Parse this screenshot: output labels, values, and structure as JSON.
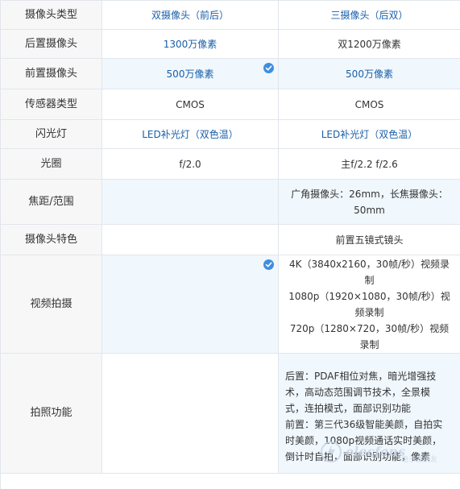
{
  "rows": [
    {
      "label": "摄像头类型",
      "a": "双摄像头（前后）",
      "b": "三摄像头（后双）"
    },
    {
      "label": "后置摄像头",
      "a": "1300万像素",
      "b": "双1200万像素"
    },
    {
      "label": "前置摄像头",
      "a": "500万像素",
      "b": "500万像素"
    },
    {
      "label": "传感器类型",
      "a": "CMOS",
      "b": "CMOS"
    },
    {
      "label": "闪光灯",
      "a": "LED补光灯（双色温）",
      "b": "LED补光灯（双色温）"
    },
    {
      "label": "光圈",
      "a": "f/2.0",
      "b": "主f/2.2 f/2.6"
    },
    {
      "label": "焦距/范围",
      "a": "",
      "b_lines": [
        "广角摄像头：26mm，长焦摄像头：",
        "50mm"
      ]
    },
    {
      "label": "摄像头特色",
      "a": "",
      "b": "前置五镜式镜头"
    },
    {
      "label": "视频拍摄",
      "a": "",
      "b_lines": [
        "4K（3840x2160，30帧/秒）视频录",
        "制",
        "1080p（1920×1080，30帧/秒）视",
        "频录制",
        "720p（1280×720，30帧/秒）视频",
        "录制"
      ]
    },
    {
      "label": "拍照功能",
      "a": "",
      "b_lines": [
        "后置：PDAF相位对焦，暗光增强技",
        "术，高动态范围调节技术，全景模",
        "式，连拍模式，面部识别功能",
        "前置：第三代36级智能美颜，自拍实",
        "时美颜，1080p视频通话实时美颜，",
        "倒计时自拍，面部识别功能，像素"
      ]
    }
  ],
  "watermark": {
    "text": "elecfans",
    "sub": "电子发烧友",
    "icon": "lightning-logo-icon"
  },
  "colors": {
    "accent": "#3f8ede",
    "link": "#1a5fa8",
    "border": "#e1e6ec",
    "highlight": "#f0f7fd"
  }
}
